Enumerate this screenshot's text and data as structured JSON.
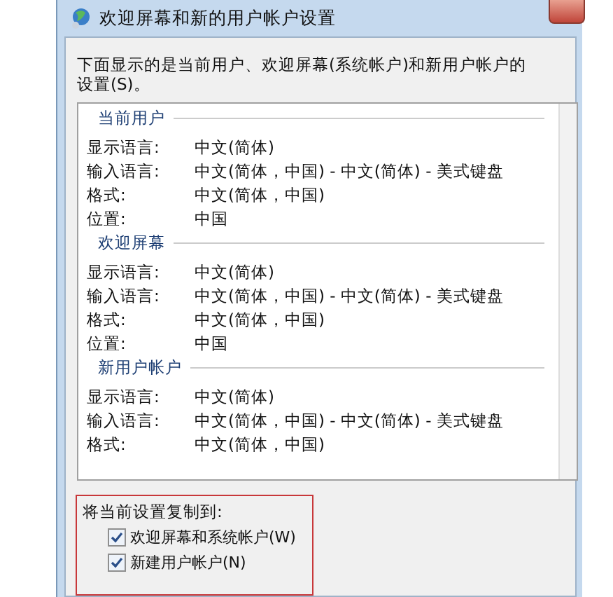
{
  "window": {
    "title": "欢迎屏幕和新的用户帐户设置"
  },
  "description": "下面显示的是当前用户、欢迎屏幕(系统帐户)和新用户帐户的设置(S)。",
  "sections": [
    {
      "title": "当前用户",
      "rows": [
        {
          "label": "显示语言:",
          "value": "中文(简体)"
        },
        {
          "label": "输入语言:",
          "value": "中文(简体，中国) - 中文(简体) - 美式键盘"
        },
        {
          "label": "格式:",
          "value": "中文(简体，中国)"
        },
        {
          "label": "位置:",
          "value": "中国"
        }
      ]
    },
    {
      "title": "欢迎屏幕",
      "rows": [
        {
          "label": "显示语言:",
          "value": "中文(简体)"
        },
        {
          "label": "输入语言:",
          "value": "中文(简体，中国) - 中文(简体) - 美式键盘"
        },
        {
          "label": "格式:",
          "value": "中文(简体，中国)"
        },
        {
          "label": "位置:",
          "value": "中国"
        }
      ]
    },
    {
      "title": "新用户帐户",
      "rows": [
        {
          "label": "显示语言:",
          "value": "中文(简体)"
        },
        {
          "label": "输入语言:",
          "value": "中文(简体，中国) - 中文(简体) - 美式键盘"
        },
        {
          "label": "格式:",
          "value": "中文(简体，中国)"
        }
      ]
    }
  ],
  "copy_group": {
    "title": "将当前设置复制到:",
    "options": [
      {
        "label": "欢迎屏幕和系统帐户(W)",
        "checked": true
      },
      {
        "label": "新建用户帐户(N)",
        "checked": true
      }
    ]
  }
}
